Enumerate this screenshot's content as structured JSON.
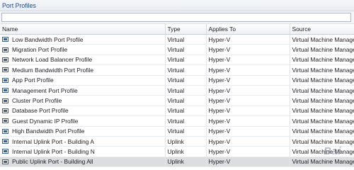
{
  "window": {
    "title": "Port Profiles"
  },
  "search": {
    "value": "",
    "placeholder": ""
  },
  "columns": [
    "Name",
    "Type",
    "Applies To",
    "Source"
  ],
  "rows": [
    {
      "name": "Low Bandwidth Port Profile",
      "type": "Virtual",
      "applies_to": "Hyper-V",
      "source": "Virtual Machine Manager"
    },
    {
      "name": "Migration Port Profile",
      "type": "Virtual",
      "applies_to": "Hyper-V",
      "source": "Virtual Machine Manager"
    },
    {
      "name": "Network Load Balancer Profile",
      "type": "Virtual",
      "applies_to": "Hyper-V",
      "source": "Virtual Machine Manager"
    },
    {
      "name": "Medium Bandwidth Port Profile",
      "type": "Virtual",
      "applies_to": "Hyper-V",
      "source": "Virtual Machine Manager"
    },
    {
      "name": "App Port Profile",
      "type": "Virtual",
      "applies_to": "Hyper-V",
      "source": "Virtual Machine Manager"
    },
    {
      "name": "Management Port Profile",
      "type": "Virtual",
      "applies_to": "Hyper-V",
      "source": "Virtual Machine Manager"
    },
    {
      "name": "Cluster Port Profile",
      "type": "Virtual",
      "applies_to": "Hyper-V",
      "source": "Virtual Machine Manager"
    },
    {
      "name": "Database Port Profile",
      "type": "Virtual",
      "applies_to": "Hyper-V",
      "source": "Virtual Machine Manager"
    },
    {
      "name": "Guest Dynamic IP Profile",
      "type": "Virtual",
      "applies_to": "Hyper-V",
      "source": "Virtual Machine Manager"
    },
    {
      "name": "High Bandwidth Port Profile",
      "type": "Virtual",
      "applies_to": "Hyper-V",
      "source": "Virtual Machine Manager"
    },
    {
      "name": "Internal Uplink Port - Building A",
      "type": "Uplink",
      "applies_to": "Hyper-V",
      "source": "Virtual Machine Manager"
    },
    {
      "name": "Internal Uplink Port - Building N",
      "type": "Uplink",
      "applies_to": "Hyper-V",
      "source": "Virtual Machine Manager"
    },
    {
      "name": "Public Uplink Port - Building All",
      "type": "Uplink",
      "applies_to": "Hyper-V",
      "source": "Virtual Machine Manager",
      "selected": true
    }
  ],
  "icons": {
    "row_icon": "port-profile-icon"
  },
  "colors": {
    "title_text": "#2a4a78",
    "icon_fill": "#3a5f8f",
    "selected_row": "#dcdde0"
  },
  "watermark": {
    "text": "Bai"
  }
}
